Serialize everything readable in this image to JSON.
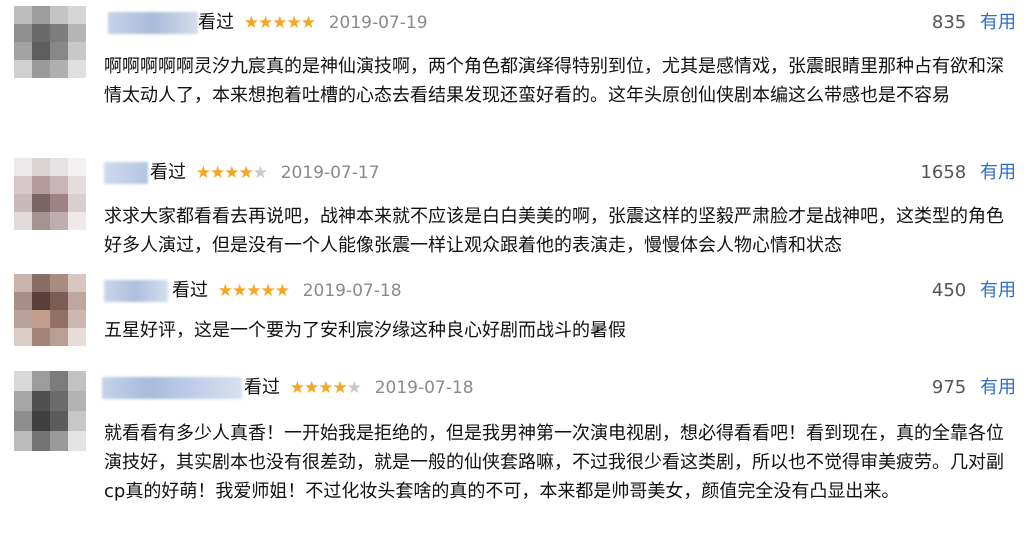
{
  "colors": {
    "star": "#f5a623",
    "star_off": "#c9c9c9",
    "date": "#8a8a8a",
    "useful_link": "#2f6fc2"
  },
  "reviews": [
    {
      "status": "看过",
      "rating": 5,
      "date": "2019-07-19",
      "useful_count": "835",
      "useful_label": "有用",
      "text": "啊啊啊啊啊灵汐九宸真的是神仙演技啊，两个角色都演绎得特别到位，尤其是感情戏，张震眼睛里那种占有欲和深情太动人了，本来想抱着吐槽的心态去看结果发现还蛮好看的。这年头原创仙侠剧本编这么带感也是不容易"
    },
    {
      "status": "看过",
      "rating": 4,
      "date": "2019-07-17",
      "useful_count": "1658",
      "useful_label": "有用",
      "text": "求求大家都看看去再说吧，战神本来就不应该是白白美美的啊，张震这样的坚毅严肃脸才是战神吧，这类型的角色好多人演过，但是没有一个人能像张震一样让观众跟着他的表演走，慢慢体会人物心情和状态"
    },
    {
      "status": "看过",
      "rating": 5,
      "date": "2019-07-18",
      "useful_count": "450",
      "useful_label": "有用",
      "text": "五星好评，这是一个要为了安利宸汐缘这种良心好剧而战斗的暑假"
    },
    {
      "status": "看过",
      "rating": 4,
      "date": "2019-07-18",
      "useful_count": "975",
      "useful_label": "有用",
      "text": "就看看有多少人真香！一开始我是拒绝的，但是我男神第一次演电视剧，想必得看看吧！看到现在，真的全靠各位演技好，其实剧本也没有很差劲，就是一般的仙侠套路嘛，不过我很少看这类剧，所以也不觉得审美疲劳。几对副cp真的好萌！我爱师姐！不过化妆头套啥的真的不可，本来都是帅哥美女，颜值完全没有凸显出来。"
    }
  ]
}
